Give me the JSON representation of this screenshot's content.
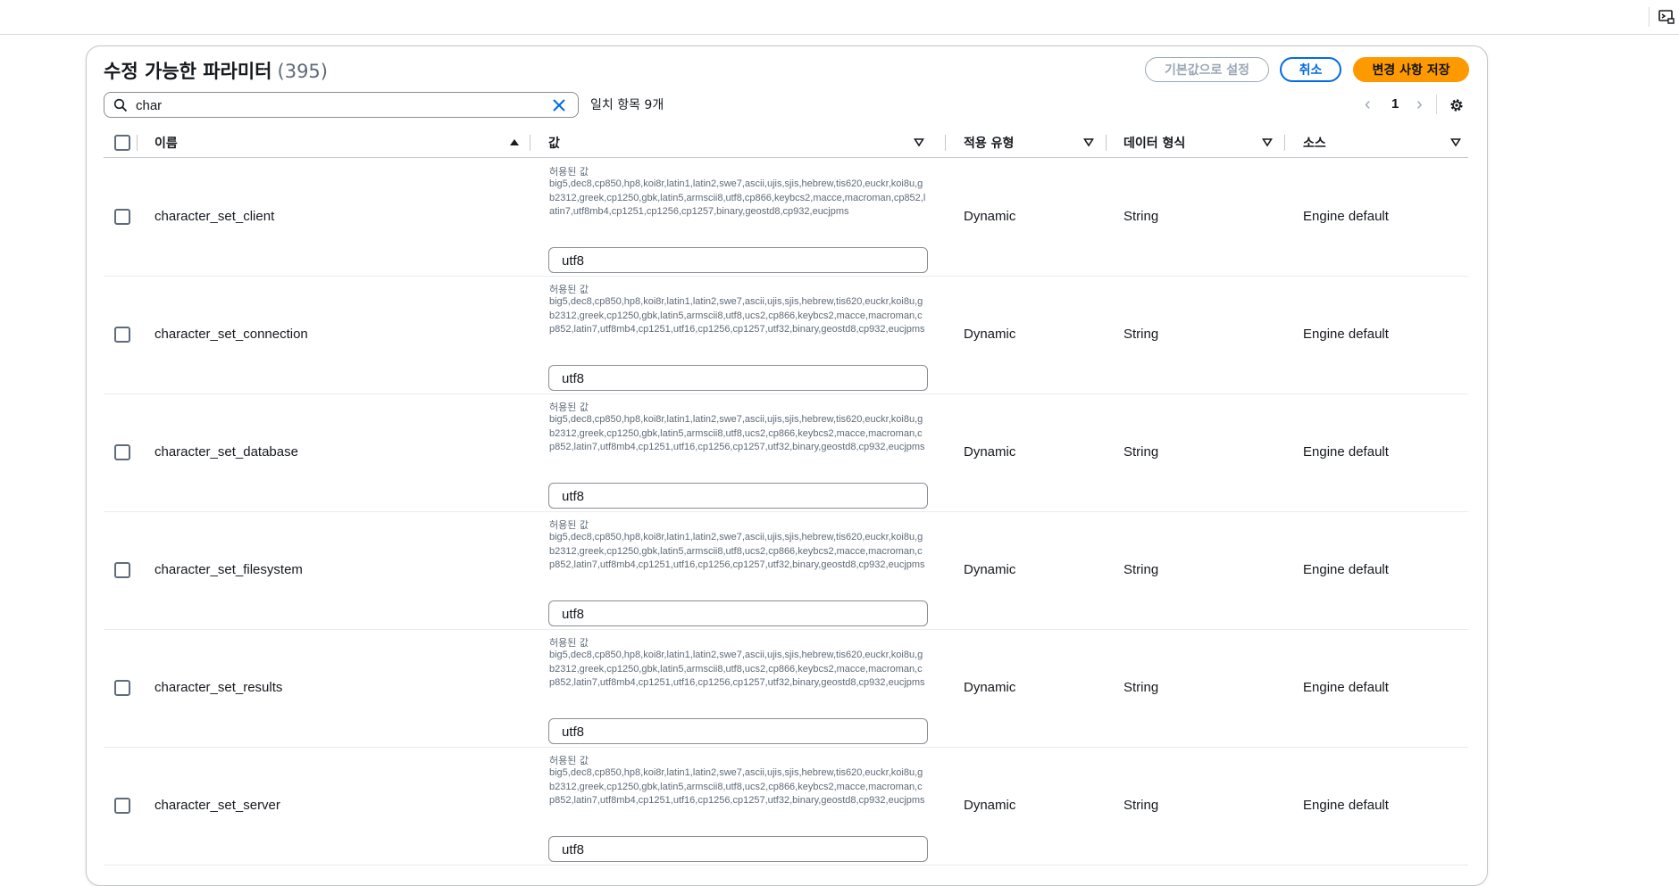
{
  "header": {
    "title": "수정 가능한 파라미터",
    "count": "(395)",
    "buttons": {
      "reset_default": "기본값으로 설정",
      "cancel": "취소",
      "save": "변경 사항 저장"
    }
  },
  "search": {
    "value": "char",
    "matches_text": "일치 항목 9개"
  },
  "pagination": {
    "current_page": "1"
  },
  "table": {
    "columns": {
      "name": "이름",
      "value": "값",
      "apply_type": "적용 유형",
      "data_type": "데이터 형식",
      "source": "소스"
    },
    "allowed_label": "허용된 값",
    "rows": [
      {
        "name": "character_set_client",
        "allowed": "big5,dec8,cp850,hp8,koi8r,latin1,latin2,swe7,ascii,ujis,sjis,hebrew,tis620,euckr,koi8u,gb2312,greek,cp1250,gbk,latin5,armscii8,utf8,cp866,keybcs2,macce,macroman,cp852,latin7,utf8mb4,cp1251,cp1256,cp1257,binary,geostd8,cp932,eucjpms",
        "value": "utf8",
        "apply_type": "Dynamic",
        "data_type": "String",
        "source": "Engine default"
      },
      {
        "name": "character_set_connection",
        "allowed": "big5,dec8,cp850,hp8,koi8r,latin1,latin2,swe7,ascii,ujis,sjis,hebrew,tis620,euckr,koi8u,gb2312,greek,cp1250,gbk,latin5,armscii8,utf8,ucs2,cp866,keybcs2,macce,macroman,cp852,latin7,utf8mb4,cp1251,utf16,cp1256,cp1257,utf32,binary,geostd8,cp932,eucjpms",
        "value": "utf8",
        "apply_type": "Dynamic",
        "data_type": "String",
        "source": "Engine default"
      },
      {
        "name": "character_set_database",
        "allowed": "big5,dec8,cp850,hp8,koi8r,latin1,latin2,swe7,ascii,ujis,sjis,hebrew,tis620,euckr,koi8u,gb2312,greek,cp1250,gbk,latin5,armscii8,utf8,ucs2,cp866,keybcs2,macce,macroman,cp852,latin7,utf8mb4,cp1251,utf16,cp1256,cp1257,utf32,binary,geostd8,cp932,eucjpms",
        "value": "utf8",
        "apply_type": "Dynamic",
        "data_type": "String",
        "source": "Engine default"
      },
      {
        "name": "character_set_filesystem",
        "allowed": "big5,dec8,cp850,hp8,koi8r,latin1,latin2,swe7,ascii,ujis,sjis,hebrew,tis620,euckr,koi8u,gb2312,greek,cp1250,gbk,latin5,armscii8,utf8,ucs2,cp866,keybcs2,macce,macroman,cp852,latin7,utf8mb4,cp1251,utf16,cp1256,cp1257,utf32,binary,geostd8,cp932,eucjpms",
        "value": "utf8",
        "apply_type": "Dynamic",
        "data_type": "String",
        "source": "Engine default"
      },
      {
        "name": "character_set_results",
        "allowed": "big5,dec8,cp850,hp8,koi8r,latin1,latin2,swe7,ascii,ujis,sjis,hebrew,tis620,euckr,koi8u,gb2312,greek,cp1250,gbk,latin5,armscii8,utf8,ucs2,cp866,keybcs2,macce,macroman,cp852,latin7,utf8mb4,cp1251,utf16,cp1256,cp1257,utf32,binary,geostd8,cp932,eucjpms",
        "value": "utf8",
        "apply_type": "Dynamic",
        "data_type": "String",
        "source": "Engine default"
      },
      {
        "name": "character_set_server",
        "allowed": "big5,dec8,cp850,hp8,koi8r,latin1,latin2,swe7,ascii,ujis,sjis,hebrew,tis620,euckr,koi8u,gb2312,greek,cp1250,gbk,latin5,armscii8,utf8,ucs2,cp866,keybcs2,macce,macroman,cp852,latin7,utf8mb4,cp1251,utf16,cp1256,cp1257,utf32,binary,geostd8,cp932,eucjpms",
        "value": "utf8",
        "apply_type": "Dynamic",
        "data_type": "String",
        "source": "Engine default"
      }
    ]
  },
  "icons": {
    "search": "search-icon",
    "clear": "close-icon",
    "settings": "gear-icon",
    "cloudshell": "cloudshell-icon"
  },
  "colors": {
    "primary_button": "#ff9900",
    "link_blue": "#006ce0",
    "disabled": "#9ba7b6"
  }
}
